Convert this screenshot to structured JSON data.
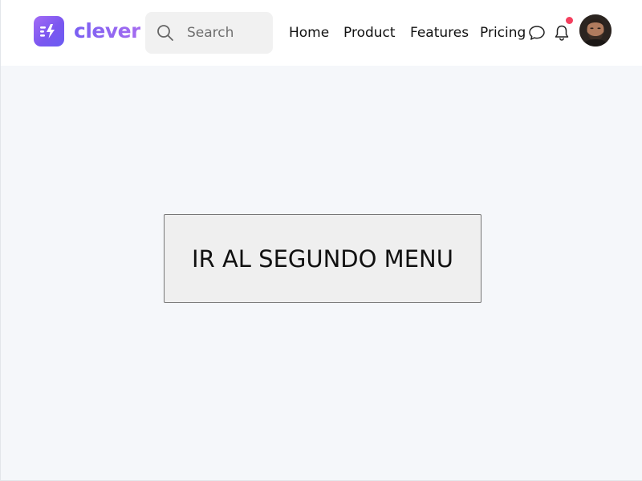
{
  "brand": {
    "name": "clever",
    "logo_icon": "lightning-bolt-icon",
    "accent_color": "#8a63f2"
  },
  "search": {
    "placeholder": "Search",
    "value": "",
    "icon": "search-icon"
  },
  "nav": {
    "links": [
      {
        "label": "Home"
      },
      {
        "label": "Product"
      },
      {
        "label": "Features"
      },
      {
        "label": "Pricing"
      }
    ]
  },
  "header_icons": {
    "chat": "chat-bubble-icon",
    "notifications": "bell-icon",
    "notification_dot_color": "#f43f5e"
  },
  "main": {
    "button_label": "IR AL SEGUNDO MENU"
  }
}
